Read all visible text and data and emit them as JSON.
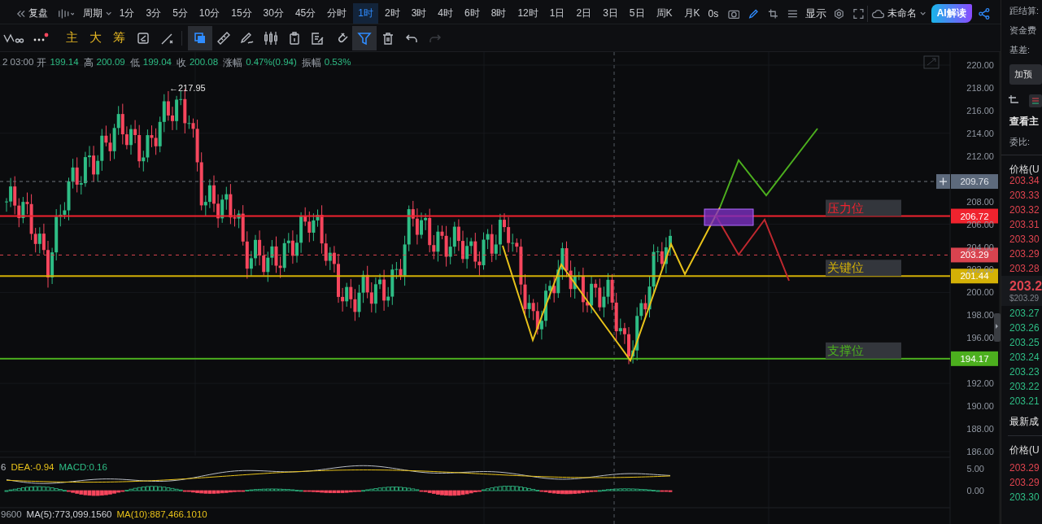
{
  "toolbar": {
    "replay": "复盘",
    "period_menu": "周期",
    "intervals": [
      {
        "label": "1分",
        "selected": false
      },
      {
        "label": "3分",
        "selected": false
      },
      {
        "label": "5分",
        "selected": false
      },
      {
        "label": "10分",
        "selected": false
      },
      {
        "label": "15分",
        "selected": false
      },
      {
        "label": "30分",
        "selected": false
      },
      {
        "label": "45分",
        "selected": false
      },
      {
        "label": "分时",
        "selected": false
      },
      {
        "label": "1时",
        "selected": true
      },
      {
        "label": "2时",
        "selected": false
      },
      {
        "label": "3时",
        "selected": false
      },
      {
        "label": "4时",
        "selected": false
      },
      {
        "label": "6时",
        "selected": false
      },
      {
        "label": "8时",
        "selected": false
      },
      {
        "label": "12时",
        "selected": false
      },
      {
        "label": "1日",
        "selected": false
      },
      {
        "label": "2日",
        "selected": false
      },
      {
        "label": "3日",
        "selected": false
      },
      {
        "label": "5日",
        "selected": false
      },
      {
        "label": "周K",
        "selected": false
      },
      {
        "label": "月K",
        "selected": false
      }
    ],
    "timer": "0s",
    "display": "显示",
    "layout_name": "未命名",
    "ai_button": "AI解读"
  },
  "tools": {
    "main_indicators": [
      "主",
      "大",
      "筹"
    ],
    "items": [
      {
        "kind": "shape",
        "selected": true,
        "disabled": false
      },
      {
        "kind": "ruler",
        "selected": false,
        "disabled": false
      },
      {
        "kind": "pen",
        "selected": false,
        "disabled": false
      },
      {
        "kind": "candles",
        "selected": false,
        "disabled": false
      },
      {
        "kind": "clipboard",
        "selected": false,
        "disabled": false
      },
      {
        "kind": "note",
        "selected": false,
        "disabled": false
      },
      {
        "kind": "magnet",
        "selected": false,
        "disabled": false
      },
      {
        "kind": "filter",
        "selected": true,
        "disabled": false
      },
      {
        "kind": "trash",
        "selected": false,
        "disabled": false
      },
      {
        "kind": "undo",
        "selected": false,
        "disabled": false
      },
      {
        "kind": "redo",
        "selected": false,
        "disabled": true
      }
    ]
  },
  "ohlc": {
    "time": "2 03:00",
    "fields": [
      {
        "label": "开",
        "value": "199.14"
      },
      {
        "label": "高",
        "value": "200.09"
      },
      {
        "label": "低",
        "value": "199.04"
      },
      {
        "label": "收",
        "value": "200.08"
      },
      {
        "label": "涨幅",
        "value": "0.47%(0.94)"
      },
      {
        "label": "振幅",
        "value": "0.53%"
      }
    ]
  },
  "chart": {
    "high_label": "←217.95",
    "price_ticks": [
      "220.00",
      "218.00",
      "216.00",
      "214.00",
      "212.00",
      "208.00",
      "206.00",
      "204.00",
      "202.00",
      "200.00",
      "198.00",
      "196.00",
      "192.00",
      "190.00",
      "188.00",
      "186.00"
    ],
    "crosshair_price": "209.76",
    "last_price": "203.29",
    "levels": [
      {
        "label": "压力位",
        "price": "206.72",
        "color": "#f0232e"
      },
      {
        "label": "关键位",
        "price": "201.44",
        "color": "#d4b106"
      },
      {
        "label": "支撑位",
        "price": "194.17",
        "color": "#4caf1e"
      }
    ]
  },
  "macd": {
    "cut_value": "6",
    "dea": "DEA:-0.94",
    "macd": "MACD:0.16",
    "ticks": [
      "5.00",
      "0.00"
    ]
  },
  "volume": {
    "cut_value": "9600",
    "ma5": "MA(5):773,099.1560",
    "ma10": "MA(10):887,466.1010"
  },
  "side_panel": {
    "settlement": "距结算:",
    "funding": "资金费",
    "basis": "基差:",
    "alert_button": "加预",
    "order_book_title": "查看主",
    "ratio": "委比:",
    "price_header": "价格(U",
    "asks": [
      "203.34",
      "203.33",
      "203.32",
      "203.31",
      "203.30",
      "203.29",
      "203.28"
    ],
    "last": "203.2",
    "last_usd": "$203.29",
    "bids": [
      "203.27",
      "203.26",
      "203.25",
      "203.24",
      "203.23",
      "203.22",
      "203.21"
    ],
    "trades_title": "最新成",
    "trades_header": "价格(U",
    "trades": [
      {
        "price": "203.29",
        "color": "#e0444f"
      },
      {
        "price": "203.29",
        "color": "#e0444f"
      },
      {
        "price": "203.30",
        "color": "#2ebd85"
      }
    ]
  }
}
